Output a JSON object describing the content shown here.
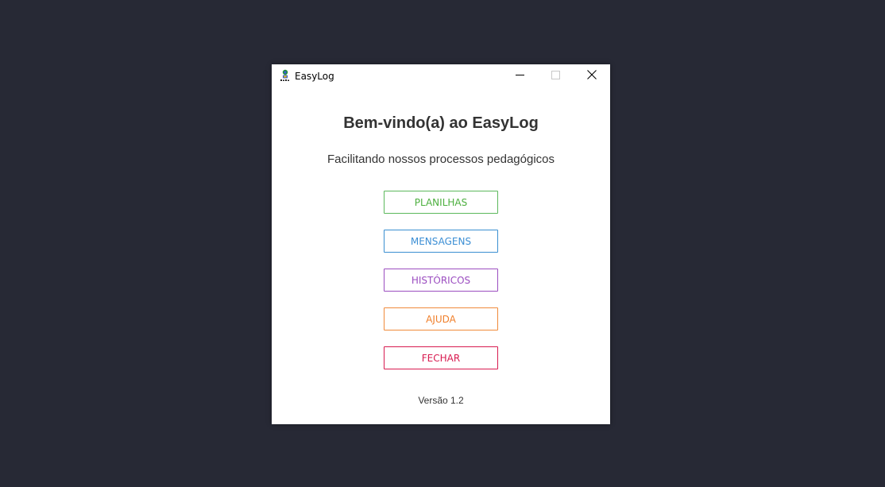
{
  "window": {
    "title": "EasyLog",
    "app_icon": "easylog-logo-icon",
    "controls": {
      "minimize_icon": "minimize-icon",
      "maximize_icon": "maximize-icon",
      "close_icon": "close-icon"
    }
  },
  "main": {
    "heading": "Bem-vindo(a) ao EasyLog",
    "subtitle": "Facilitando nossos processos pedagógicos",
    "buttons": [
      {
        "label": "PLANILHAS",
        "color": "#4caf3e"
      },
      {
        "label": "MENSAGENS",
        "color": "#3b8ed4"
      },
      {
        "label": "HISTÓRICOS",
        "color": "#9b4dc0"
      },
      {
        "label": "AJUDA",
        "color": "#f07f2a"
      },
      {
        "label": "FECHAR",
        "color": "#d81b50"
      }
    ],
    "version": "Versão 1.2"
  },
  "colors": {
    "desktop_background": "#272935",
    "window_background": "#ffffff",
    "text": "#333333"
  }
}
